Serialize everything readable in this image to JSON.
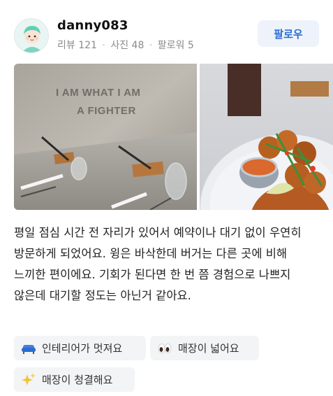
{
  "review": {
    "user": {
      "name": "danny083",
      "reviews_label": "리뷰",
      "reviews_count": "121",
      "photos_label": "사진",
      "photos_count": "48",
      "followers_label": "팔로워",
      "followers_count": "5",
      "avatar_icon": "avatar-cartoon-icon"
    },
    "follow_button": "팔로우",
    "photos": [
      {
        "icon": "restaurant-interior-photo",
        "wall_text_line1": "I AM WHAT I AM",
        "wall_text_line2": "A FIGHTER"
      },
      {
        "icon": "food-plate-photo"
      }
    ],
    "text": "평일 점심 시간 전 자리가 있어서 예약이나 대기 없이 우연히 방문하게 되었어요. 윙은 바삭한데 버거는 다른 곳에 비해 느끼한 편이에요. 기회가 된다면 한 번 쯤 경험으로 나쁘지 않은데 대기할 정도는 아닌거 같아요.",
    "tags": [
      {
        "label": "인테리어가 멋져요",
        "icon": "sofa-icon"
      },
      {
        "label": "매장이 넓어요",
        "icon": "eyes-icon"
      },
      {
        "label": "매장이 청결해요",
        "icon": "sparkles-icon"
      }
    ],
    "colors": {
      "follow_text": "#2e6fd6",
      "follow_bg": "#eef3fb",
      "tag_bg": "#f3f4f6"
    }
  }
}
